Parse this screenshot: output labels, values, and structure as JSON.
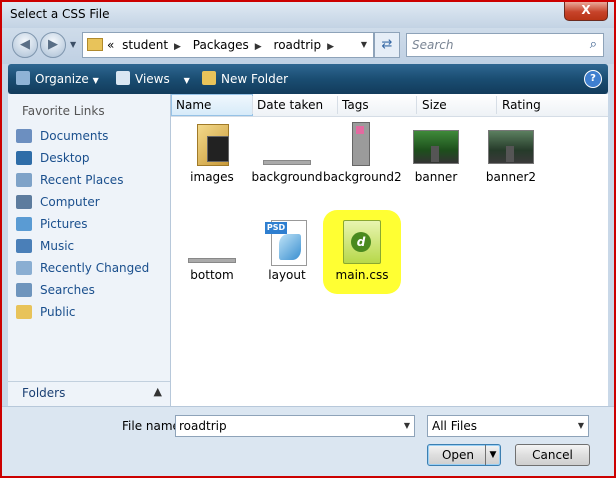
{
  "window": {
    "title": "Select a CSS File",
    "close_glyph": "X"
  },
  "nav": {
    "back_icon": "back-arrow-icon",
    "forward_icon": "forward-arrow-icon"
  },
  "address": {
    "overflow": "«",
    "crumbs": [
      "student",
      "Packages",
      "roadtrip"
    ]
  },
  "search": {
    "placeholder": "Search"
  },
  "toolbar": {
    "organize": "Organize",
    "views": "Views",
    "new_folder": "New Folder",
    "help": "?"
  },
  "sidebar": {
    "heading": "Favorite Links",
    "items": [
      {
        "label": "Documents",
        "icon": "documents-icon"
      },
      {
        "label": "Desktop",
        "icon": "desktop-icon"
      },
      {
        "label": "Recent Places",
        "icon": "recent-places-icon"
      },
      {
        "label": "Computer",
        "icon": "computer-icon"
      },
      {
        "label": "Pictures",
        "icon": "pictures-icon"
      },
      {
        "label": "Music",
        "icon": "music-icon"
      },
      {
        "label": "Recently Changed",
        "icon": "recently-changed-icon"
      },
      {
        "label": "Searches",
        "icon": "searches-icon"
      },
      {
        "label": "Public",
        "icon": "public-folder-icon"
      }
    ],
    "folders_label": "Folders"
  },
  "columns": [
    "Name",
    "Date taken",
    "Tags",
    "Size",
    "Rating"
  ],
  "files": [
    {
      "name": "images",
      "kind": "folder"
    },
    {
      "name": "background",
      "kind": "bar-image"
    },
    {
      "name": "background2",
      "kind": "tall-image"
    },
    {
      "name": "banner",
      "kind": "road-image"
    },
    {
      "name": "banner2",
      "kind": "road-image"
    },
    {
      "name": "bottom",
      "kind": "bar-image"
    },
    {
      "name": "layout",
      "kind": "psd"
    },
    {
      "name": "main.css",
      "kind": "css",
      "highlighted": true
    }
  ],
  "footer": {
    "file_name_label": "File name:",
    "file_name_value": "roadtrip",
    "filter_value": "All Files",
    "open": "Open",
    "cancel": "Cancel"
  },
  "colors": {
    "highlight": "#ffff33",
    "toolbar": "#1f5780",
    "window_border": "#cc0000"
  }
}
